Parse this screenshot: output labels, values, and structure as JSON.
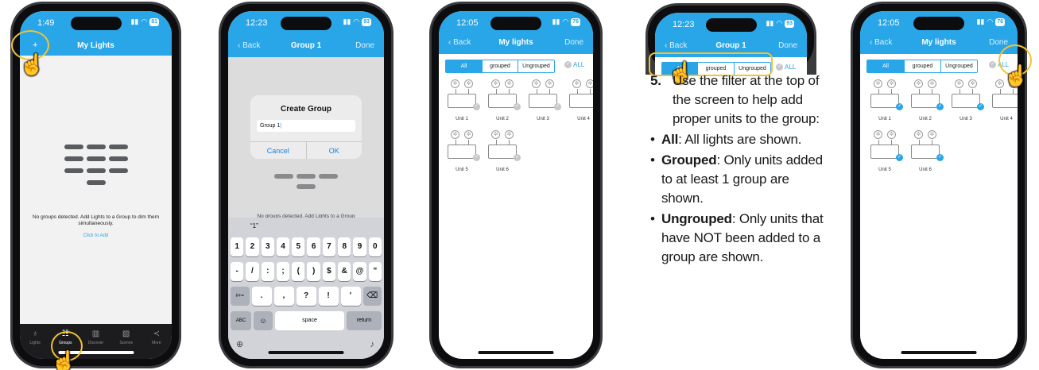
{
  "phone1": {
    "time": "1:49",
    "battery": "81",
    "title": "My Lights",
    "empty_message": "No groups detected. Add Lights to a Group to dim them simultaneously.",
    "click_to_add": "Click to Add",
    "add_icon": "plus-icon",
    "tabs": [
      {
        "label": "Lights",
        "icon": "bulb-icon"
      },
      {
        "label": "Groups",
        "icon": "groups-icon"
      },
      {
        "label": "Discover",
        "icon": "discover-icon"
      },
      {
        "label": "Scenes",
        "icon": "scenes-icon"
      },
      {
        "label": "More",
        "icon": "share-icon"
      }
    ],
    "active_tab": "Groups"
  },
  "phone2": {
    "time": "12:23",
    "battery": "93",
    "back": "Back",
    "title": "Group 1",
    "done": "Done",
    "dialog_title": "Create Group",
    "dialog_input": "Group 1",
    "cancel": "Cancel",
    "ok": "OK",
    "background_text": "No groups detected. Add Lights to a Group",
    "suggestion": "“1”",
    "keys_row1": [
      "1",
      "2",
      "3",
      "4",
      "5",
      "6",
      "7",
      "8",
      "9",
      "0"
    ],
    "keys_row2": [
      "-",
      "/",
      ":",
      ";",
      "(",
      ")",
      "$",
      "&",
      "@",
      "\""
    ],
    "keys_row3_left": "#+=",
    "keys_row3": [
      ".",
      ",",
      "?",
      "!",
      "'"
    ],
    "abc": "ABC",
    "space": "space",
    "return": "return"
  },
  "phone3": {
    "time": "12:05",
    "battery": "76",
    "back": "Back",
    "title": "My lights",
    "done": "Done",
    "filters": [
      "All",
      "grouped",
      "Ungrouped"
    ],
    "selected_filter": "All",
    "all_toggle": "ALL",
    "units": [
      "Unit 1",
      "Unit 2",
      "Unit 3",
      "Unit 4",
      "Unit 5",
      "Unit 6"
    ]
  },
  "phone4": {
    "time": "12:23",
    "battery": "93",
    "back": "Back",
    "title": "Group 1",
    "done": "Done",
    "filters": [
      "All",
      "grouped",
      "Ungrouped"
    ],
    "all_toggle": "ALL"
  },
  "phone5": {
    "time": "12:05",
    "battery": "76",
    "back": "Back",
    "title": "My lights",
    "done": "Done",
    "filters": [
      "All",
      "grouped",
      "Ungrouped"
    ],
    "all_toggle": "ALL",
    "units": [
      "Unit 1",
      "Unit 2",
      "Unit 3",
      "Unit 4",
      "Unit 5",
      "Unit 6"
    ]
  },
  "instructions": {
    "step_number": "5.",
    "step_text": "Use the filter at the top of the screen to help add proper units to the group:",
    "bullets": [
      {
        "term": "All",
        "text": ": All lights are shown."
      },
      {
        "term": "Grouped",
        "text": ": Only units added to at least 1 group are shown."
      },
      {
        "term": "Ungrouped",
        "text": ": Only units that have NOT been added to a group are shown."
      }
    ]
  },
  "colors": {
    "accent": "#29a6e8",
    "highlight": "#f2c230"
  }
}
